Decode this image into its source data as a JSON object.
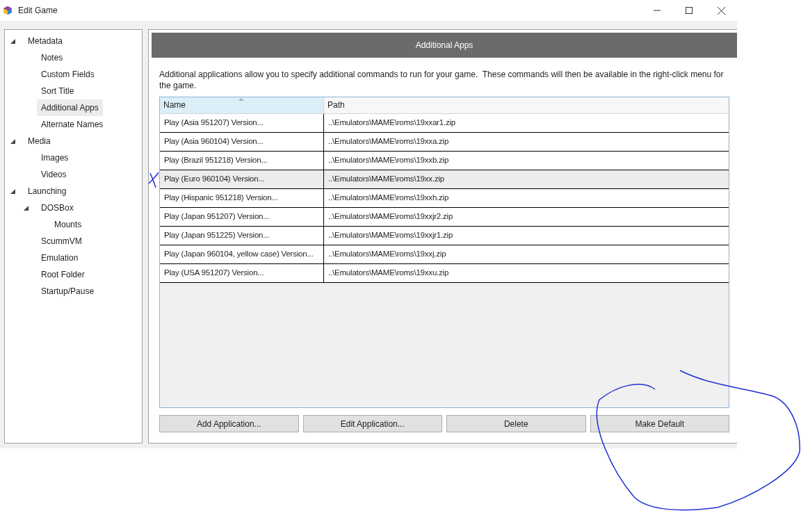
{
  "window": {
    "title": "Edit Game"
  },
  "sidebar": {
    "items": [
      {
        "label": "Metadata",
        "selected": false,
        "expanded": true,
        "children": [
          {
            "label": "Notes",
            "selected": false
          },
          {
            "label": "Custom Fields",
            "selected": false
          },
          {
            "label": "Sort Title",
            "selected": false
          },
          {
            "label": "Additional Apps",
            "selected": true
          },
          {
            "label": "Alternate Names",
            "selected": false
          }
        ]
      },
      {
        "label": "Media",
        "selected": false,
        "expanded": true,
        "children": [
          {
            "label": "Images",
            "selected": false
          },
          {
            "label": "Videos",
            "selected": false
          }
        ]
      },
      {
        "label": "Launching",
        "selected": false,
        "expanded": true,
        "children": [
          {
            "label": "DOSBox",
            "selected": false,
            "expanded": true,
            "children": [
              {
                "label": "Mounts",
                "selected": false
              }
            ]
          },
          {
            "label": "ScummVM",
            "selected": false
          },
          {
            "label": "Emulation",
            "selected": false
          },
          {
            "label": "Root Folder",
            "selected": false
          },
          {
            "label": "Startup/Pause",
            "selected": false
          }
        ]
      }
    ]
  },
  "panel": {
    "title": "Additional Apps",
    "description": "Additional applications allow you to specify additional commands to run for your game.  These commands will then be available in the right-click menu for the game."
  },
  "table": {
    "columns": [
      "Name",
      "Path"
    ],
    "rows": [
      {
        "cells": [
          "Play (Asia 951207) Version...",
          "..\\Emulators\\MAME\\roms\\19xxar1.zip"
        ],
        "selected": false
      },
      {
        "cells": [
          "Play (Asia 960104) Version...",
          "..\\Emulators\\MAME\\roms\\19xxa.zip"
        ],
        "selected": false
      },
      {
        "cells": [
          "Play (Brazil 951218) Version...",
          "..\\Emulators\\MAME\\roms\\19xxb.zip"
        ],
        "selected": false
      },
      {
        "cells": [
          "Play (Euro 960104) Version...",
          "..\\Emulators\\MAME\\roms\\19xx.zip"
        ],
        "selected": true
      },
      {
        "cells": [
          "Play (Hispanic 951218) Version...",
          "..\\Emulators\\MAME\\roms\\19xxh.zip"
        ],
        "selected": false
      },
      {
        "cells": [
          "Play (Japan 951207) Version...",
          "..\\Emulators\\MAME\\roms\\19xxjr2.zip"
        ],
        "selected": false
      },
      {
        "cells": [
          "Play (Japan 951225) Version...",
          "..\\Emulators\\MAME\\roms\\19xxjr1.zip"
        ],
        "selected": false
      },
      {
        "cells": [
          "Play (Japan 960104, yellow case) Version...",
          "..\\Emulators\\MAME\\roms\\19xxj.zip"
        ],
        "selected": false
      },
      {
        "cells": [
          "Play (USA 951207) Version...",
          "..\\Emulators\\MAME\\roms\\19xxu.zip"
        ],
        "selected": false
      }
    ]
  },
  "buttons": [
    "Add Application...",
    "Edit Application...",
    "Delete",
    "Make Default"
  ]
}
